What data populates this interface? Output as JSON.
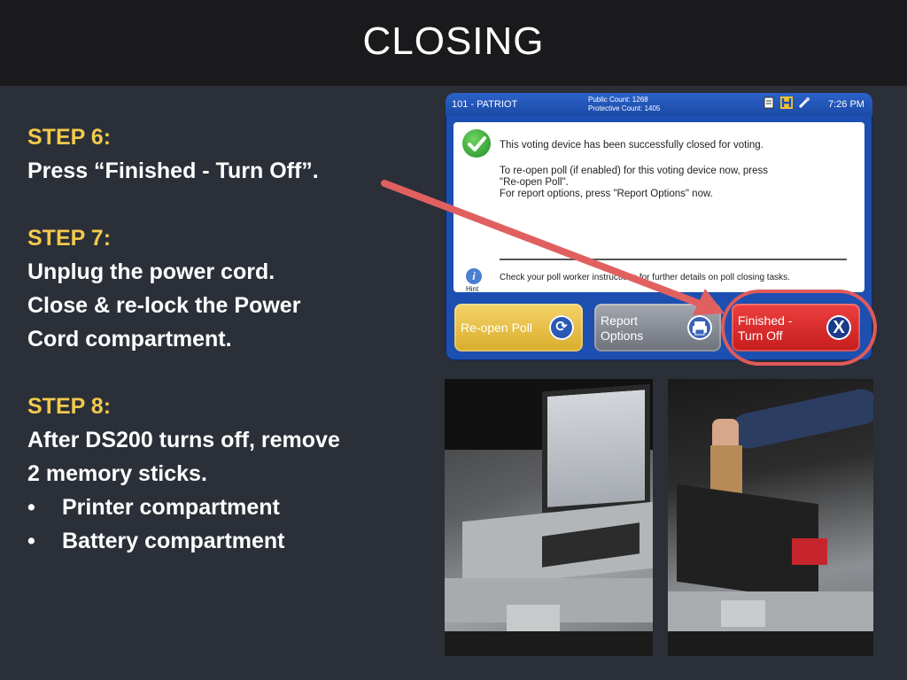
{
  "slide": {
    "title": "CLOSING"
  },
  "steps": {
    "step6": {
      "heading": "STEP 6:",
      "lines": [
        "Press “Finished - Turn Off”."
      ]
    },
    "step7": {
      "heading": "STEP 7:",
      "lines": [
        "Unplug the power cord.",
        "Close & re-lock the Power",
        "Cord compartment."
      ]
    },
    "step8": {
      "heading": "STEP 8:",
      "lines": [
        "After DS200 turns off, remove",
        "2 memory sticks."
      ],
      "bullets": [
        "Printer compartment",
        "Battery compartment"
      ],
      "bullet_symbol": "•"
    }
  },
  "screen": {
    "precinct": "101 - PATRIOT",
    "public_count": "Public Count: 1268",
    "protective_count": "Protective Count: 1405",
    "time": "7:26 PM",
    "icons": [
      "document-icon",
      "h-icon",
      "usb-icon"
    ],
    "message": {
      "line1": "This voting device has been successfully closed for voting.",
      "line2": "To re-open poll (if enabled) for this voting device now, press",
      "line3": "\"Re-open Poll\".",
      "line4": "For report options, press \"Report Options\" now."
    },
    "hint_label": "Hint",
    "hint_text": "Check your poll worker instructions for further details on poll closing tasks.",
    "buttons": {
      "reopen": "Re-open Poll",
      "report_line1": "Report",
      "report_line2": "Options",
      "finish_line1": "Finished -",
      "finish_line2": "Turn Off"
    }
  },
  "colors": {
    "step_heading": "#f2c94c",
    "highlight": "#e05a5a",
    "screen_blue": "#1d4fb0",
    "reopen_button": "#e8c04a",
    "report_button": "#8a8e96",
    "finish_button": "#d82a2a"
  }
}
